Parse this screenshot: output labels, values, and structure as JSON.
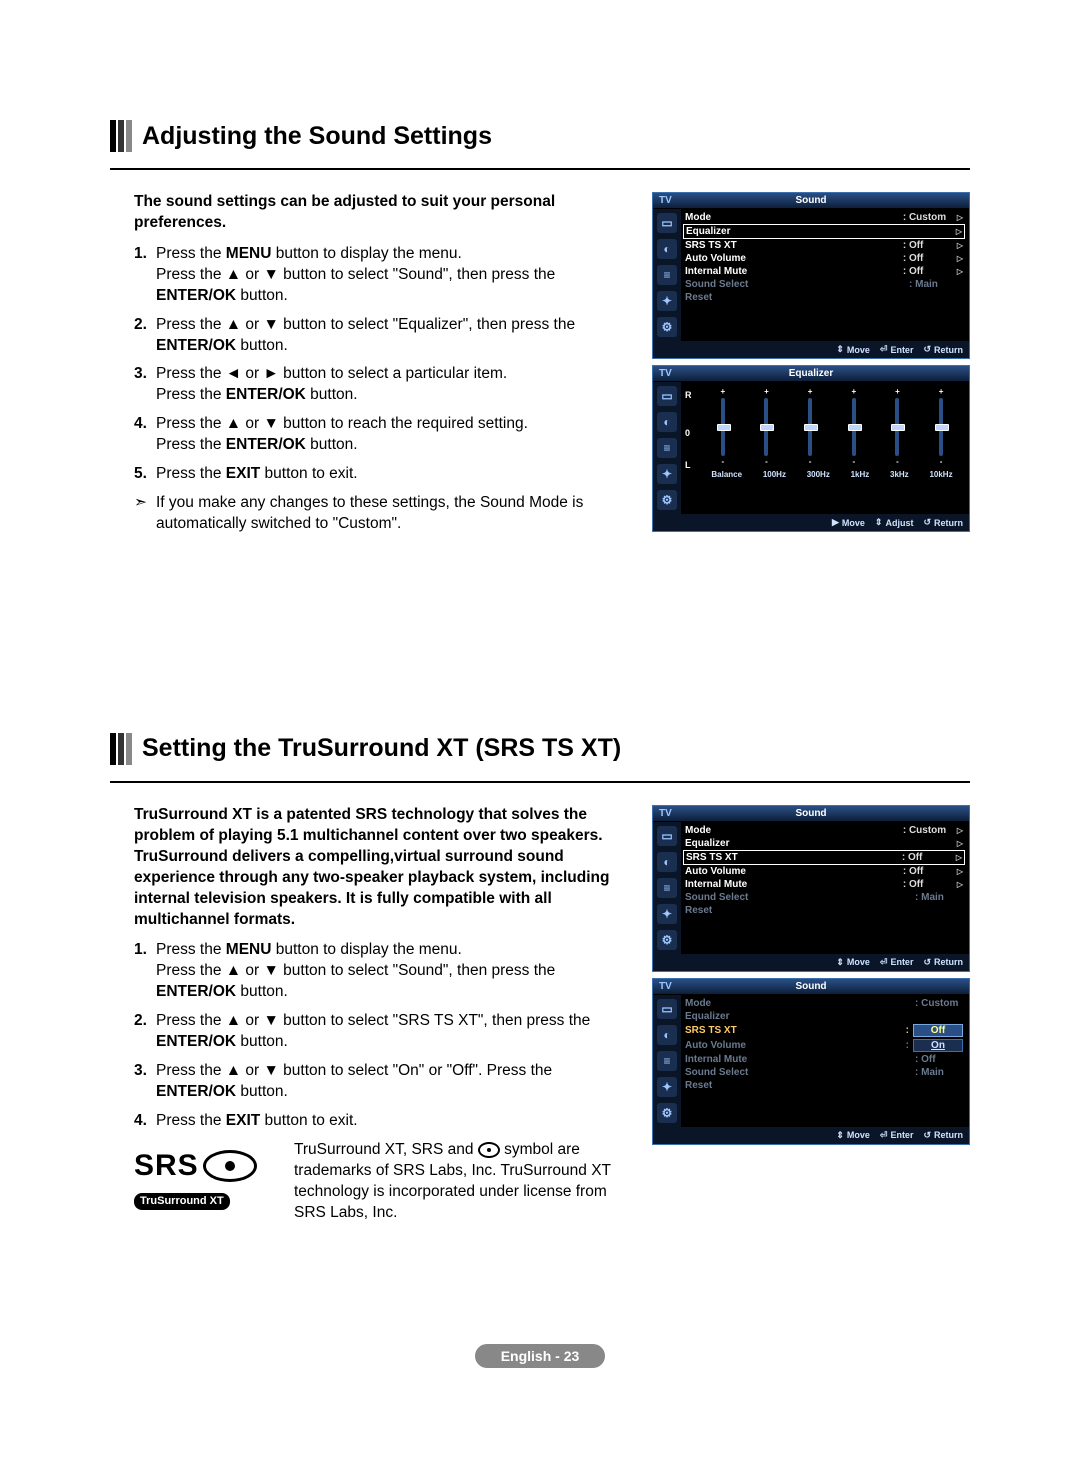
{
  "section1": {
    "title": "Adjusting the Sound Settings",
    "intro": "The sound settings can be adjusted to suit your personal preferences.",
    "steps": [
      {
        "n": "1.",
        "lines": [
          "Press the <b>MENU</b> button to display the menu.",
          "Press the ▲ or ▼ button to select \"Sound\", then press the <b>ENTER/OK</b> button."
        ]
      },
      {
        "n": "2.",
        "lines": [
          "Press the ▲ or ▼ button to select \"Equalizer\", then press the <b>ENTER/OK</b> button."
        ]
      },
      {
        "n": "3.",
        "lines": [
          "Press the ◄ or ► button to select a particular item.",
          "Press the <b>ENTER/OK</b> button."
        ]
      },
      {
        "n": "4.",
        "lines": [
          "Press the ▲ or ▼ button to reach the required setting.",
          "Press the <b>ENTER/OK</b> button."
        ]
      },
      {
        "n": "5.",
        "lines": [
          "Press the <b>EXIT</b> button to exit."
        ]
      }
    ],
    "note": "If you make any changes to these settings, the Sound Mode is automatically switched to \"Custom\"."
  },
  "section2": {
    "title": "Setting the TruSurround XT (SRS TS XT)",
    "intro": "TruSurround XT is a patented SRS technology that solves the problem of playing 5.1 multichannel content over two speakers. TruSurround delivers a compelling,virtual surround sound experience through any two-speaker playback system, including internal television speakers. It is fully compatible with all multichannel formats.",
    "steps": [
      {
        "n": "1.",
        "lines": [
          "Press the <b>MENU</b> button to display the menu.",
          "Press the ▲ or ▼ button to select \"Sound\", then press the <b>ENTER/OK</b> button."
        ]
      },
      {
        "n": "2.",
        "lines": [
          "Press the ▲ or ▼ button to select \"SRS TS XT\", then press the <b>ENTER/OK</b> button."
        ]
      },
      {
        "n": "3.",
        "lines": [
          "Press the ▲ or ▼ button to select \"On\" or \"Off\". Press the <b>ENTER/OK</b> button."
        ]
      },
      {
        "n": "4.",
        "lines": [
          "Press the <b>EXIT</b> button to exit."
        ]
      }
    ],
    "trademark_pre": "TruSurround XT, SRS and ",
    "trademark_post": " symbol are trademarks of SRS Labs, Inc. TruSurround XT technology is incorporated under license from SRS Labs, Inc.",
    "logo_text": "SRS",
    "logo_pill": "TruSurround XT"
  },
  "osd": {
    "tv": "TV",
    "sound_title": "Sound",
    "eq_title": "Equalizer",
    "rows": {
      "mode": "Mode",
      "mode_val": "Custom",
      "equalizer": "Equalizer",
      "srs": "SRS TS XT",
      "srs_val": "Off",
      "autov": "Auto Volume",
      "autov_val": "Off",
      "imute": "Internal Mute",
      "imute_val": "Off",
      "ssel": "Sound Select",
      "ssel_val": "Main",
      "reset": "Reset"
    },
    "srs_submenu_off": "Off",
    "srs_submenu_on": "On",
    "hints": {
      "move": "Move",
      "enter": "Enter",
      "return": "Return",
      "adjust": "Adjust"
    },
    "eq_labels": {
      "R": "R",
      "L": "L",
      "zero": "0"
    },
    "eq_bands": [
      "Balance",
      "100Hz",
      "300Hz",
      "1kHz",
      "3kHz",
      "10kHz"
    ]
  },
  "footer": "English - 23",
  "glyphs": {
    "note_arrow": "➣",
    "tri_right": "▷",
    "updown": "⇕",
    "leftright": "↔",
    "enter": "⏎",
    "return": "↺",
    "play": "▶"
  }
}
